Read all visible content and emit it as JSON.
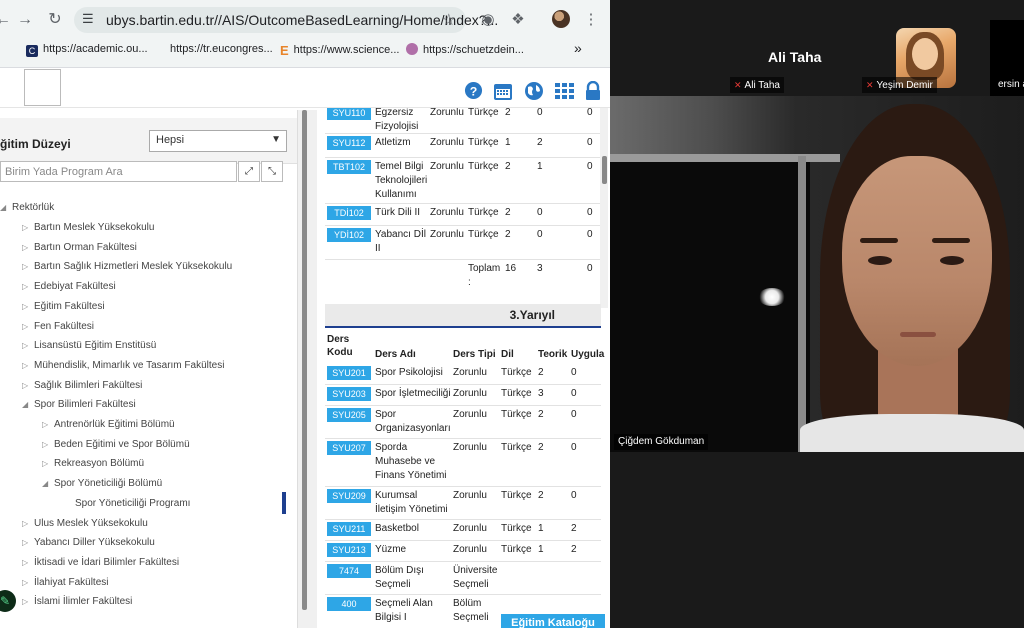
{
  "browser": {
    "url": "ubys.bartin.edu.tr//AIS/OutcomeBasedLearning/Home/Index?...",
    "bookmarks": [
      {
        "label": "https://academic.ou...",
        "color": "#1a2b5e"
      },
      {
        "label": "https://tr.eucongres...",
        "color": "#ffffff"
      },
      {
        "label": "https://www.science...",
        "color": "#f29c38"
      },
      {
        "label": "https://schuetzdein...",
        "color": "#b06fa8"
      }
    ],
    "more_bookmarks": "»",
    "logo_letter_E": "E"
  },
  "left": {
    "filter_label": "ğitim Düzeyi",
    "filter_value": "Hepsi",
    "search_placeholder": "Birim Yada Program Ara",
    "tree": [
      {
        "label": "Rektörlük",
        "level": 0,
        "expanded": true
      },
      {
        "label": "Bartın Meslek Yüksekokulu",
        "level": 1
      },
      {
        "label": "Bartın Orman Fakültesi",
        "level": 1
      },
      {
        "label": "Bartın Sağlık Hizmetleri Meslek Yüksekokulu",
        "level": 1
      },
      {
        "label": "Edebiyat Fakültesi",
        "level": 1
      },
      {
        "label": "Eğitim Fakültesi",
        "level": 1
      },
      {
        "label": "Fen Fakültesi",
        "level": 1
      },
      {
        "label": "Lisansüstü Eğitim Enstitüsü",
        "level": 1
      },
      {
        "label": "Mühendislik, Mimarlık ve Tasarım Fakültesi",
        "level": 1
      },
      {
        "label": "Sağlık Bilimleri Fakültesi",
        "level": 1
      },
      {
        "label": "Spor Bilimleri Fakültesi",
        "level": 1,
        "expanded": true
      },
      {
        "label": "Antrenörlük Eğitimi Bölümü",
        "level": 2
      },
      {
        "label": "Beden Eğitimi ve Spor Bölümü",
        "level": 2
      },
      {
        "label": "Rekreasyon Bölümü",
        "level": 2
      },
      {
        "label": "Spor Yöneticiliği Bölümü",
        "level": 2,
        "expanded": true
      },
      {
        "label": "Spor Yöneticiliği Programı",
        "level": 3,
        "selected": true
      },
      {
        "label": "Ulus Meslek Yüksekokulu",
        "level": 1
      },
      {
        "label": "Yabancı Diller Yüksekokulu",
        "level": 1
      },
      {
        "label": "İktisadi ve İdari Bilimler Fakültesi",
        "level": 1
      },
      {
        "label": "İlahiyat Fakültesi",
        "level": 1
      },
      {
        "label": "İslami İlimler Fakültesi",
        "level": 1
      }
    ]
  },
  "table_prev": {
    "rows": [
      {
        "code": "SYU110",
        "name": "Egzersiz\nFizyolojisi",
        "type": "Zorunlu",
        "lang": "Türkçe",
        "theory": "2",
        "practice": "0",
        "extra": "0"
      },
      {
        "code": "SYU112",
        "name": "Atletizm",
        "type": "Zorunlu",
        "lang": "Türkçe",
        "theory": "1",
        "practice": "2",
        "extra": "0"
      },
      {
        "code": "TBT102",
        "name": "Temel Bilgi\nTeknolojileri\nKullanımı",
        "type": "Zorunlu",
        "lang": "Türkçe",
        "theory": "2",
        "practice": "1",
        "extra": "0"
      },
      {
        "code": "TDİ102",
        "name": "Türk Dili II",
        "type": "Zorunlu",
        "lang": "Türkçe",
        "theory": "2",
        "practice": "0",
        "extra": "0"
      },
      {
        "code": "YDİ102",
        "name": "Yabancı Dİl\nII",
        "type": "Zorunlu",
        "lang": "Türkçe",
        "theory": "2",
        "practice": "0",
        "extra": "0"
      }
    ],
    "total_label": "Toplam\n:",
    "total_theory": "16",
    "total_practice": "3",
    "total_extra": "0"
  },
  "table_3": {
    "title": "3.Yarıyıl",
    "headers": {
      "code": "Ders\nKodu",
      "name": "Ders Adı",
      "type": "Ders Tipi",
      "lang": "Dil",
      "theory": "Teorik",
      "practice": "Uygula"
    },
    "rows": [
      {
        "code": "SYU201",
        "name": "Spor Psikolojisi",
        "type": "Zorunlu",
        "lang": "Türkçe",
        "theory": "2",
        "practice": "0"
      },
      {
        "code": "SYU203",
        "name": "Spor İşletmeciliği",
        "type": "Zorunlu",
        "lang": "Türkçe",
        "theory": "3",
        "practice": "0"
      },
      {
        "code": "SYU205",
        "name": "Spor\nOrganizasyonları",
        "type": "Zorunlu",
        "lang": "Türkçe",
        "theory": "2",
        "practice": "0"
      },
      {
        "code": "SYU207",
        "name": "Sporda\nMuhasebe ve\nFinans Yönetimi",
        "type": "Zorunlu",
        "lang": "Türkçe",
        "theory": "2",
        "practice": "0"
      },
      {
        "code": "SYU209",
        "name": "Kurumsal\nİletişim Yönetimi",
        "type": "Zorunlu",
        "lang": "Türkçe",
        "theory": "2",
        "practice": "0"
      },
      {
        "code": "SYU211",
        "name": "Basketbol",
        "type": "Zorunlu",
        "lang": "Türkçe",
        "theory": "1",
        "practice": "2"
      },
      {
        "code": "SYU213",
        "name": "Yüzme",
        "type": "Zorunlu",
        "lang": "Türkçe",
        "theory": "1",
        "practice": "2"
      },
      {
        "code": "7474",
        "name": "Bölüm Dışı\nSeçmeli",
        "type": "Üniversite\nSeçmeli",
        "lang": "",
        "theory": "",
        "practice": ""
      },
      {
        "code": "400",
        "name": "Seçmeli Alan\nBilgisi I",
        "type": "Bölüm\nSeçmeli",
        "lang": "",
        "theory": "",
        "practice": ""
      }
    ],
    "catalog_button": "Eğitim Kataloğu"
  },
  "zoom": {
    "top_name": "Ali Taha",
    "participants": [
      "Ali Taha",
      "Yeşim Demir",
      "ersin a"
    ],
    "main_speaker": "Çiğdem Gökduman"
  }
}
